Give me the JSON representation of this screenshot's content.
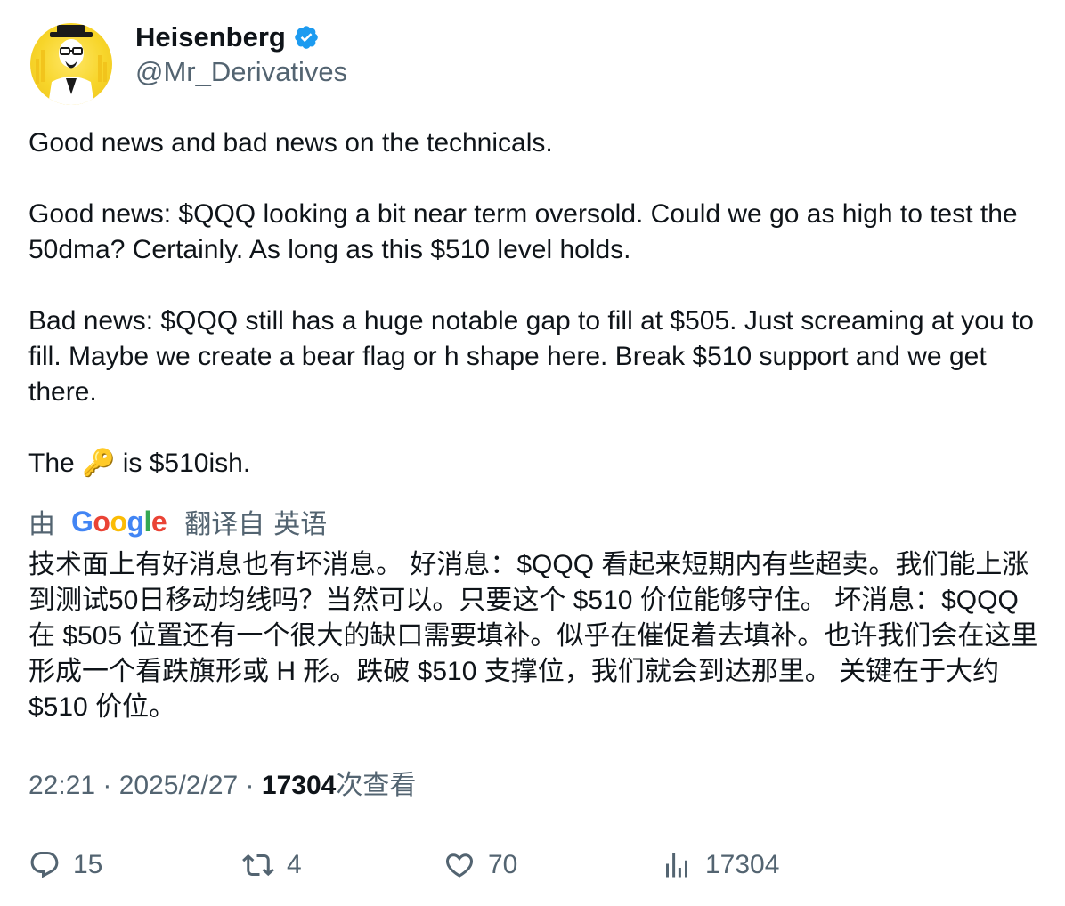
{
  "author": {
    "display_name": "Heisenberg",
    "handle": "@Mr_Derivatives",
    "verified_color": "#1d9bf0",
    "avatar_bg": "#f7d52a"
  },
  "tweet": {
    "paragraphs": [
      "Good news and bad news on the technicals.",
      "Good news: $QQQ looking a bit near term oversold. Could we go as high to test the 50dma? Certainly. As long as this $510 level holds.",
      "Bad news: $QQQ still has a huge notable gap to fill at $505. Just screaming at you to fill. Maybe we create a bear flag or h shape here. Break $510 support and we get there."
    ],
    "last_line_prefix": "The ",
    "last_line_emoji": "🔑",
    "last_line_suffix": " is $510ish."
  },
  "translation": {
    "by_label": "由",
    "provider": "Google",
    "from_label": "翻译自",
    "language": "英语",
    "text": "技术面上有好消息也有坏消息。 好消息：$QQQ 看起来短期内有些超卖。我们能上涨到测试50日移动均线吗？当然可以。只要这个 $510 价位能够守住。 坏消息：$QQQ 在 $505 位置还有一个很大的缺口需要填补。似乎在催促着去填补。也许我们会在这里形成一个看跌旗形或 H 形。跌破 $510 支撑位，我们就会到达那里。 关键在于大约 $510 价位。"
  },
  "meta": {
    "time": "22:21",
    "separator": " · ",
    "date": "2025/2/27",
    "views": "17304",
    "views_label": "次查看"
  },
  "actions": {
    "replies": "15",
    "retweets": "4",
    "likes": "70",
    "views": "17304",
    "icon_color": "#536471"
  }
}
